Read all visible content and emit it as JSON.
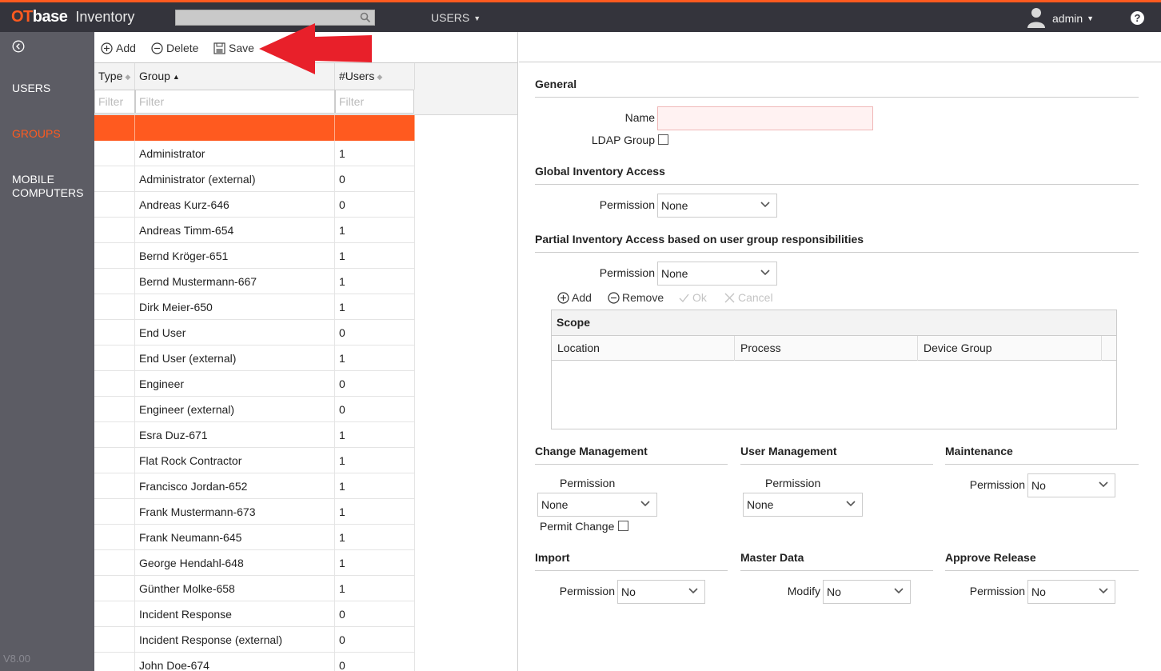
{
  "header": {
    "brand_ot": "OT",
    "brand_base": "base",
    "brand_app": "Inventory",
    "search_placeholder": "",
    "menu_label": "USERS",
    "user_name": "admin",
    "help_label": "?"
  },
  "sidebar": {
    "items": [
      {
        "label": "USERS"
      },
      {
        "label": "GROUPS"
      },
      {
        "label": "MOBILE COMPUTERS"
      }
    ],
    "version": "V8.00"
  },
  "toolbar": {
    "add_label": "Add",
    "delete_label": "Delete",
    "save_label": "Save"
  },
  "grid": {
    "columns": [
      "Type",
      "Group",
      "#Users"
    ],
    "filter_placeholder": "Filter",
    "rows": [
      {
        "type": "",
        "group": "",
        "users": ""
      },
      {
        "type": "",
        "group": "Administrator",
        "users": "1"
      },
      {
        "type": "",
        "group": "Administrator (external)",
        "users": "0"
      },
      {
        "type": "",
        "group": "Andreas Kurz-646",
        "users": "0"
      },
      {
        "type": "",
        "group": "Andreas Timm-654",
        "users": "1"
      },
      {
        "type": "",
        "group": "Bernd Kröger-651",
        "users": "1"
      },
      {
        "type": "",
        "group": "Bernd Mustermann-667",
        "users": "1"
      },
      {
        "type": "",
        "group": "Dirk Meier-650",
        "users": "1"
      },
      {
        "type": "",
        "group": "End User",
        "users": "0"
      },
      {
        "type": "",
        "group": "End User (external)",
        "users": "1"
      },
      {
        "type": "",
        "group": "Engineer",
        "users": "0"
      },
      {
        "type": "",
        "group": "Engineer (external)",
        "users": "0"
      },
      {
        "type": "",
        "group": "Esra Duz-671",
        "users": "1"
      },
      {
        "type": "",
        "group": "Flat Rock Contractor",
        "users": "1"
      },
      {
        "type": "",
        "group": "Francisco Jordan-652",
        "users": "1"
      },
      {
        "type": "",
        "group": "Frank Mustermann-673",
        "users": "1"
      },
      {
        "type": "",
        "group": "Frank Neumann-645",
        "users": "1"
      },
      {
        "type": "",
        "group": "George Hendahl-648",
        "users": "1"
      },
      {
        "type": "",
        "group": "Günther Molke-658",
        "users": "1"
      },
      {
        "type": "",
        "group": "Incident Response",
        "users": "0"
      },
      {
        "type": "",
        "group": "Incident Response (external)",
        "users": "0"
      },
      {
        "type": "",
        "group": "John Doe-674",
        "users": "0"
      }
    ]
  },
  "form": {
    "general": {
      "title": "General",
      "name_label": "Name",
      "name_value": "",
      "ldap_label": "LDAP Group"
    },
    "global": {
      "title": "Global Inventory Access",
      "permission_label": "Permission",
      "permission_value": "None"
    },
    "partial": {
      "title": "Partial Inventory Access based on user group responsibilities",
      "permission_label": "Permission",
      "permission_value": "None",
      "add_label": "Add",
      "remove_label": "Remove",
      "ok_label": "Ok",
      "cancel_label": "Cancel",
      "scope_title": "Scope",
      "scope_columns": [
        "Location",
        "Process",
        "Device Group"
      ]
    },
    "change_mgmt": {
      "title": "Change Management",
      "permission_label": "Permission",
      "permission_value": "None",
      "permit_change_label": "Permit Change"
    },
    "user_mgmt": {
      "title": "User Management",
      "permission_label": "Permission",
      "permission_value": "None"
    },
    "maintenance": {
      "title": "Maintenance",
      "permission_label": "Permission",
      "permission_value": "No"
    },
    "import": {
      "title": "Import",
      "permission_label": "Permission",
      "permission_value": "No"
    },
    "master_data": {
      "title": "Master Data",
      "modify_label": "Modify",
      "modify_value": "No"
    },
    "approve_release": {
      "title": "Approve Release",
      "permission_label": "Permission",
      "permission_value": "No"
    }
  },
  "colors": {
    "accent": "#ff5a1f",
    "topbar": "#34343c",
    "sidebar": "#5c5c64",
    "annotation_arrow": "#e8202a"
  }
}
